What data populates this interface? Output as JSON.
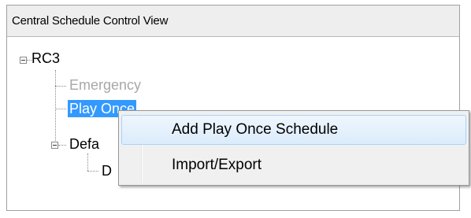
{
  "panel": {
    "title": "Central Schedule Control View"
  },
  "tree": {
    "root_label": "RC3",
    "items": [
      {
        "label": "Emergency",
        "state": "disabled"
      },
      {
        "label": "Play Once",
        "state": "selected"
      },
      {
        "label": "Defa",
        "state": "normal",
        "expanded": true
      },
      {
        "label": "D",
        "state": "normal"
      }
    ]
  },
  "context_menu": {
    "items": [
      {
        "label": "Add Play Once Schedule",
        "hovered": true
      },
      {
        "label": "Import/Export",
        "hovered": false
      }
    ]
  },
  "colors": {
    "selection": "#3399ff",
    "disabled_text": "#a8a8a8",
    "header_bg": "#eeeeee",
    "menu_bg": "#f0f0f0",
    "menu_hover_border": "#a8d2fb"
  }
}
